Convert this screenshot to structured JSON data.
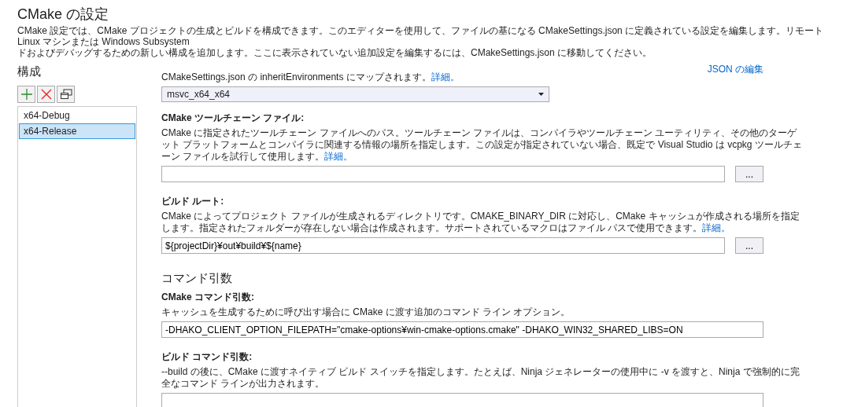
{
  "header": {
    "title": "CMake の設定",
    "lines": [
      "CMake 設定では、CMake プロジェクトの生成とビルドを構成できます。このエディターを使用して、ファイルの基になる CMakeSettings.json に定義されている設定を編集します。リモート Linux マシンまたは Windows Subsystem",
      "ドおよびデバッグするための新しい構成を追加します。ここに表示されていない追加設定を編集するには、CMakeSettings.json に移動してください。"
    ]
  },
  "sidebar": {
    "heading": "構成",
    "toolbar": [
      {
        "kind": "add"
      },
      {
        "kind": "remove"
      },
      {
        "kind": "copy"
      }
    ],
    "configurations": [
      {
        "label": "x64-Debug",
        "selected": false
      },
      {
        "label": "x64-Release",
        "selected": true
      }
    ]
  },
  "edit_json_link": "JSON の編集",
  "settings": [
    {
      "kind": "dropdown",
      "description": "CMakeSettings.json の inheritEnvironments にマップされます。",
      "link": "詳細。",
      "value": "msvc_x64_x64"
    },
    {
      "kind": "path",
      "label": "CMake ツールチェーン ファイル:",
      "description": "CMake に指定されたツールチェーン ファイルへのパス。ツールチェーン ファイルは、コンパイラやツールチェーン ユーティリティ、その他のターゲット プラットフォームとコンパイラに関連する情報の場所を指定します。この設定が指定されていない場合、既定で Visual Studio は vcpkg ツールチェーン ファイルを試行して使用します。",
      "link": "詳細。",
      "browse": "..."
    },
    {
      "kind": "path",
      "label": "ビルド ルート:",
      "description": "CMake によってプロジェクト ファイルが生成されるディレクトリです。CMAKE_BINARY_DIR に対応し、CMake キャッシュが作成される場所を指定します。指定されたフォルダーが存在しない場合は作成されます。サポートされているマクロはファイル パスで使用できます。",
      "link": "詳細。",
      "value": "${projectDir}¥out¥build¥${name}",
      "browse": "..."
    },
    {
      "kind": "heading",
      "label": "コマンド引数"
    },
    {
      "kind": "text",
      "label": "CMake コマンド引数:",
      "description": "キャッシュを生成するために呼び出す場合に CMake に渡す追加のコマンド ライン オプション。",
      "value": "-DHAKO_CLIENT_OPTION_FILEPATH=\"cmake-options¥win-cmake-options.cmake\" -DHAKO_WIN32_SHARED_LIBS=ON"
    },
    {
      "kind": "text",
      "label": "ビルド コマンド引数:",
      "description": "--build の後に、CMake に渡すネイティブ ビルド スイッチを指定します。たとえば、Ninja ジェネレーターの使用中に -v を渡すと、Ninja で強制的に完全なコマンド ラインが出力されます。"
    }
  ]
}
